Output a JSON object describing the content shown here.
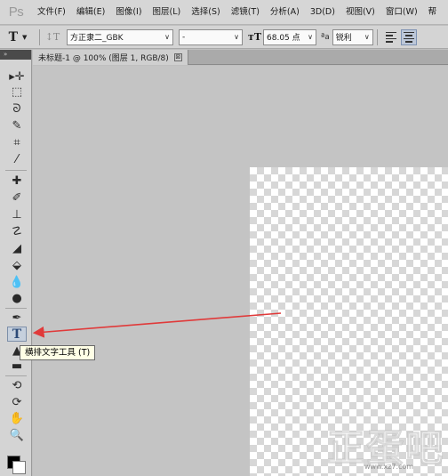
{
  "app": {
    "logo": "Ps"
  },
  "menu": [
    "文件(F)",
    "编辑(E)",
    "图像(I)",
    "图层(L)",
    "选择(S)",
    "滤镜(T)",
    "分析(A)",
    "3D(D)",
    "视图(V)",
    "窗口(W)",
    "帮"
  ],
  "options": {
    "tool_glyph": "T",
    "font_family": "方正隶二_GBK",
    "font_style": "-",
    "font_size": "68.05 点",
    "antialias": "锐利",
    "antialias_glyph": "ªa"
  },
  "document": {
    "tab_title": "未标题-1 @ 100% (图层 1, RGB/8)",
    "close_glyph": "⊠"
  },
  "tooltip": {
    "text": "横排文字工具 (T)"
  },
  "tools_panel": {
    "collapse_glyph": "»"
  },
  "annotation": {
    "arrow_color": "#e03a3a"
  },
  "watermark": {
    "text": "正蛋吧",
    "url": "www.xz7.com"
  }
}
